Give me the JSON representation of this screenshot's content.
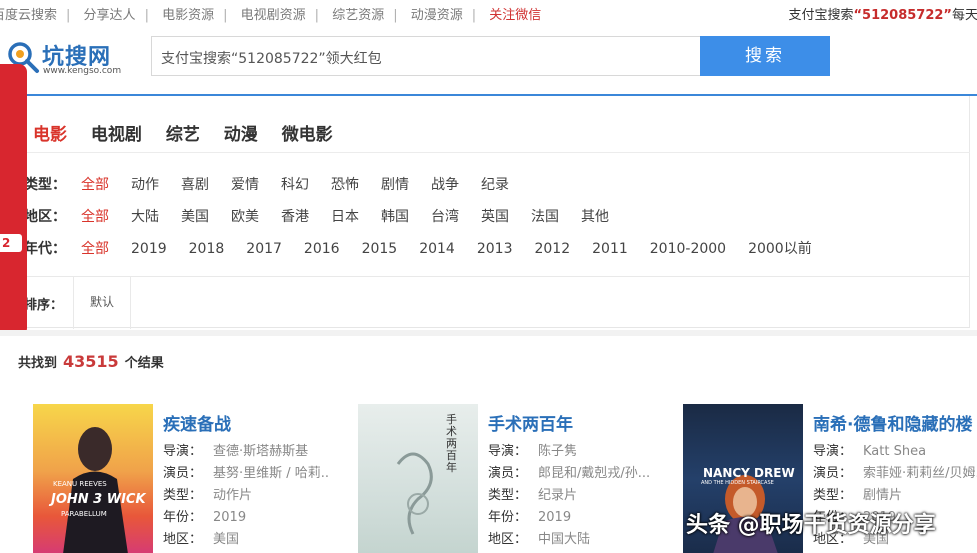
{
  "top_links": [
    {
      "label": "百度云搜索",
      "highlight": false
    },
    {
      "label": "分享达人",
      "highlight": false
    },
    {
      "label": "电影资源",
      "highlight": false
    },
    {
      "label": "电视剧资源",
      "highlight": false
    },
    {
      "label": "综艺资源",
      "highlight": false
    },
    {
      "label": "动漫资源",
      "highlight": false
    },
    {
      "label": "关注微信",
      "highlight": true
    }
  ],
  "promo": {
    "prefix": "支付宝搜索",
    "code": "“512085722”",
    "suffix": "每天领红包"
  },
  "logo": {
    "title": "坑搜网",
    "subtitle": "www.kengso.com",
    "icon": "magnifier-logo-icon"
  },
  "search": {
    "value": "支付宝搜索“512085722”领大红包",
    "button": "搜索"
  },
  "side_tab": {
    "badge": "2"
  },
  "category_tabs": [
    {
      "label": "电影",
      "active": true
    },
    {
      "label": "电视剧",
      "active": false
    },
    {
      "label": "综艺",
      "active": false
    },
    {
      "label": "动漫",
      "active": false
    },
    {
      "label": "微电影",
      "active": false
    }
  ],
  "filters": {
    "type": {
      "label": "类型：",
      "options": [
        "全部",
        "动作",
        "喜剧",
        "爱情",
        "科幻",
        "恐怖",
        "剧情",
        "战争",
        "纪录"
      ]
    },
    "region": {
      "label": "地区：",
      "options": [
        "全部",
        "大陆",
        "美国",
        "欧美",
        "香港",
        "日本",
        "韩国",
        "台湾",
        "英国",
        "法国",
        "其他"
      ]
    },
    "year": {
      "label": "年代：",
      "options": [
        "全部",
        "2019",
        "2018",
        "2017",
        "2016",
        "2015",
        "2014",
        "2013",
        "2012",
        "2011",
        "2010-2000",
        "2000以前"
      ]
    }
  },
  "sort": {
    "label": "排序：",
    "option": "默认"
  },
  "results": {
    "prefix": "共找到",
    "count": "43515",
    "suffix": "个结果"
  },
  "movies": [
    {
      "title": "疾速备战",
      "poster_text": {
        "line1": "KEANU REEVES",
        "line2": "JOHN 3 WICK",
        "line3": "PARABELLUM"
      },
      "info": [
        {
          "k": "导演：",
          "v": "查德·斯塔赫斯基"
        },
        {
          "k": "演员：",
          "v": "基努·里维斯 / 哈莉.."
        },
        {
          "k": "类型：",
          "v": "动作片"
        },
        {
          "k": "年份：",
          "v": "2019"
        },
        {
          "k": "地区：",
          "v": "美国"
        }
      ]
    },
    {
      "title": "手术两百年",
      "poster_text": {
        "line1": "手术两百年"
      },
      "info": [
        {
          "k": "导演：",
          "v": "陈子隽"
        },
        {
          "k": "演员：",
          "v": "郎昆和/戴剋戎/孙..."
        },
        {
          "k": "类型：",
          "v": "纪录片"
        },
        {
          "k": "年份：",
          "v": "2019"
        },
        {
          "k": "地区：",
          "v": "中国大陆"
        }
      ]
    },
    {
      "title": "南希·德鲁和隐藏的楼",
      "poster_text": {
        "line1": "NANCY DREW",
        "line2": "AND THE HIDDEN STAIRCASE"
      },
      "info": [
        {
          "k": "导演：",
          "v": "Katt Shea"
        },
        {
          "k": "演员：",
          "v": "索菲娅·莉莉丝/贝姆.."
        },
        {
          "k": "类型：",
          "v": "剧情片"
        },
        {
          "k": "年份：",
          "v": "2019"
        },
        {
          "k": "地区：",
          "v": "美国"
        }
      ]
    }
  ],
  "watermark": "头条 @职场干货资源分享",
  "colors": {
    "accent_red": "#d9342b",
    "link_blue": "#2a6fb8",
    "button_blue": "#3d8ee8",
    "side_tab_red": "#d8262f"
  }
}
